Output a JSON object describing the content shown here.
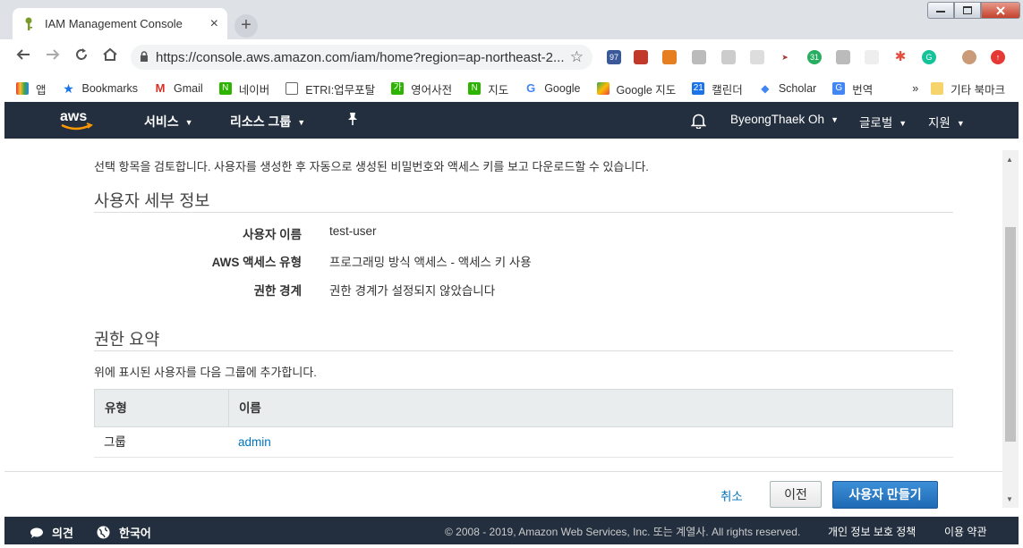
{
  "browser": {
    "tab_title": "IAM Management Console",
    "tab_close": "×",
    "new_tab": "+",
    "url": "https://console.aws.amazon.com/iam/home?region=ap-northeast-2...",
    "bookmarks": [
      "앱",
      "Bookmarks",
      "Gmail",
      "네이버",
      "ETRI:업무포탈",
      "영어사전",
      "지도",
      "Google",
      "Google 지도",
      "캘린더",
      "Scholar",
      "번역"
    ],
    "bookmarks_more": "»",
    "other_bookmarks": "기타 북마크",
    "ext_badges": [
      "97",
      "31"
    ]
  },
  "aws_nav": {
    "services": "서비스",
    "resource_groups": "리소스 그룹",
    "user": "ByeongThaek Oh",
    "region": "글로벌",
    "support": "지원"
  },
  "review": {
    "intro": "선택 항목을 검토합니다. 사용자를 생성한 후 자동으로 생성된 비밀번호와 액세스 키를 보고 다운로드할 수 있습니다.",
    "details_title": "사용자 세부 정보",
    "details": [
      {
        "label": "사용자 이름",
        "value": "test-user"
      },
      {
        "label": "AWS 액세스 유형",
        "value": "프로그래밍 방식 액세스 - 액세스 키 사용"
      },
      {
        "label": "권한 경계",
        "value": "권한 경계가 설정되지 않았습니다"
      }
    ],
    "perm_title": "권한 요약",
    "perm_sub": "위에 표시된 사용자를 다음 그룹에 추가합니다.",
    "table": {
      "headers": [
        "유형",
        "이름"
      ],
      "rows": [
        [
          "그룹",
          "admin"
        ]
      ]
    }
  },
  "actions": {
    "cancel": "취소",
    "previous": "이전",
    "create": "사용자 만들기"
  },
  "footer": {
    "feedback": "의견",
    "language": "한국어",
    "copyright": "© 2008 - 2019, Amazon Web Services, Inc. 또는 계열사. All rights reserved.",
    "privacy": "개인 정보 보호 정책",
    "terms": "이용 약관"
  },
  "colors": {
    "aws_nav": "#232f3e",
    "link": "#0073bb",
    "primary_button": "#1f6ab4"
  }
}
